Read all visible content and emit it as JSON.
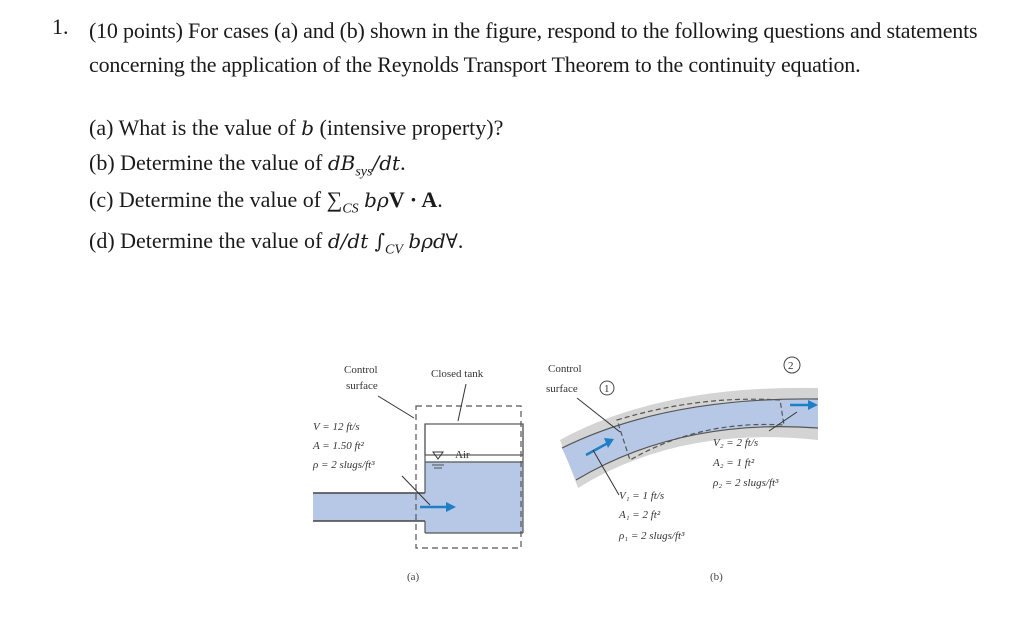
{
  "question": {
    "number": "1.",
    "intro": "(10 points) For cases (a) and (b) shown in the figure, respond to the following questions and statements concerning the application of the Reynolds Transport Theorem to the continuity equation.",
    "parts": [
      {
        "label": "(a)",
        "text": "What is the value of",
        "math": "b",
        "suffix": "(intensive property)?"
      },
      {
        "label": "(b)",
        "text": "Determine the value of",
        "math": "dB",
        "math_sub": "sys",
        "math_after": "/dt",
        "suffix": "."
      },
      {
        "label": "(c)",
        "text": "Determine the value of",
        "math": "∑",
        "math_sub": "CS",
        "math_after": "bρ",
        "bold": "V · A",
        "suffix": "."
      },
      {
        "label": "(d)",
        "text": "Determine the value of",
        "math": "d/dt ∫",
        "math_sub": "CV",
        "math_after": "bρd∀",
        "suffix": "."
      }
    ]
  },
  "figure": {
    "a": {
      "caption": "(a)",
      "control_surface_label": [
        "Control",
        "surface"
      ],
      "closed_tank_label": "Closed tank",
      "air_label": "Air",
      "values": [
        "V = 12 ft/s",
        "A = 1.50 ft²",
        "ρ = 2 slugs/ft³"
      ]
    },
    "b": {
      "caption": "(b)",
      "control_surface_label": [
        "Control",
        "surface"
      ],
      "section1": "1",
      "section2": "2",
      "values1": [
        "V₁ = 1 ft/s",
        "A₁ = 2 ft²",
        "ρ₁ = 2 slugs/ft³"
      ],
      "values2": [
        "V₂ = 2 ft/s",
        "A₂ = 1 ft²",
        "ρ₂ = 2 slugs/ft³"
      ]
    },
    "colors": {
      "water": "#b7c8e6",
      "pipe_wall": "#d4d4d4",
      "arrow": "#1f7fc4",
      "line": "#444444"
    }
  }
}
